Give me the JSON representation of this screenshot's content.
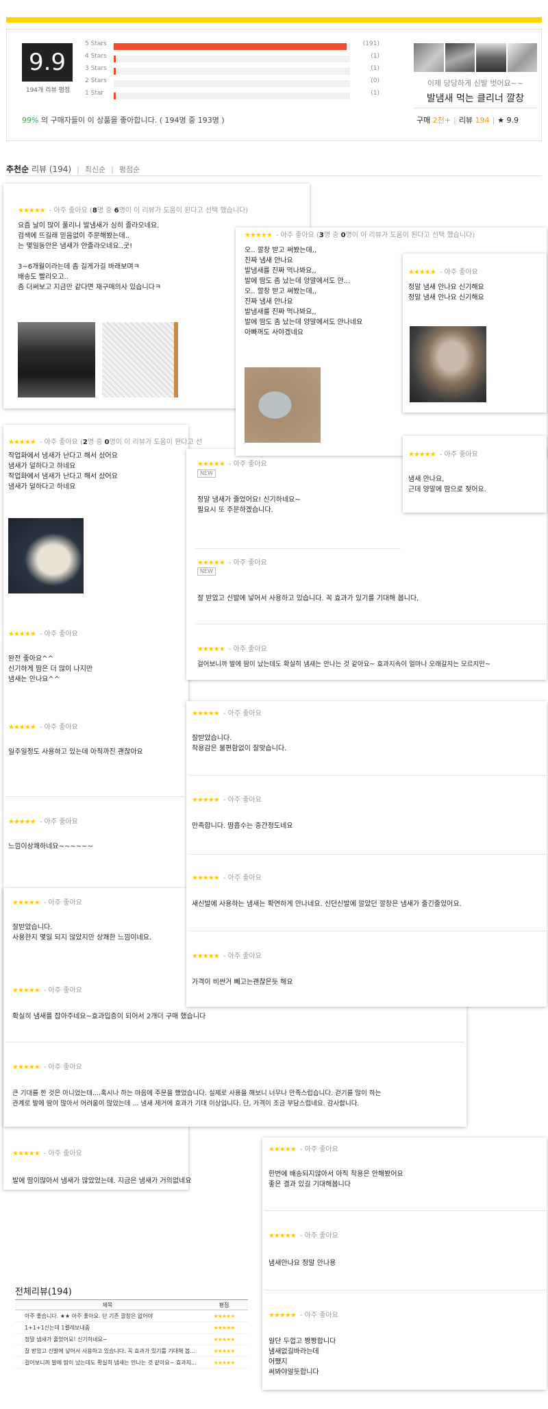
{
  "summary": {
    "score": "9.9",
    "score_caption": "194개 리뷰 평점",
    "rating_rows": [
      {
        "label": "5 Stars",
        "count": "(191)",
        "fraction": 0.985
      },
      {
        "label": "4 Stars",
        "count": "(1)",
        "fraction": 0.005
      },
      {
        "label": "3 Stars",
        "count": "(1)",
        "fraction": 0.005
      },
      {
        "label": "2 Stars",
        "count": "(0)",
        "fraction": 0
      },
      {
        "label": "1 Star",
        "count": "(1)",
        "fraction": 0.005
      }
    ],
    "pct": "99%",
    "pct_text": " 의 구매자들이 이 상품을 좋아합니다. ( 194명 중 193명 )"
  },
  "product": {
    "subtitle": "이제 당당하게 신발 벗어요~~",
    "title": "발냄새 먹는 클리너 깔창",
    "buy_label": "구매",
    "buy_value": "2천+",
    "review_label": "리뷰",
    "review_value": "194",
    "rating": "★ 9.9"
  },
  "sort": {
    "active_label": "추천순",
    "active_suffix": " 리뷰 (194)",
    "option_latest": "최신순",
    "option_rating": "평점순"
  },
  "colors": {
    "accent": "#ffd400",
    "bar": "#f04b2c",
    "star": "#ffc600",
    "positive": "#2fa84f",
    "highlight": "#f39a12"
  },
  "stars": "★★★★★",
  "reviews": {
    "r1": {
      "grade": "- 아주 좋아요",
      "helpful_pre": "(",
      "helpful_a": "8",
      "helpful_mid": "명 중 ",
      "helpful_b": "6",
      "helpful_post": "명이 이 리뷰가 도움이 된다고 선택 했습니다)",
      "text": "요즘 날이 많이 풀리니 발냄새가 심히 졸라오네요.\n검색에 뜨길래 믿음없이 주문해봤는데..\n는 몇일동안은 냄새가 안졸라오네요..굿!\n\n3~6개월이라는데 좀 길게가길 바래보며ㅋ\n배송도 빨리오고..\n좀 더써보고 지금만 같다면 재구매의사 있습니다ㅋ"
    },
    "r2": {
      "grade": "- 아주 좋아요",
      "helpful_pre": "(",
      "helpful_a": "3",
      "helpful_mid": "명 중 ",
      "helpful_b": "0",
      "helpful_post": "명이 이 리뷰가 도움이 된다고 선택 했습니다)",
      "text": "오.. 깔창 받고 써봤는데,,\n진짜 냄새 안나요\n발냄새를 진짜 먹나봐요,,\n발에 땀도 좀 났는데 양말에서도 안...\n오.. 깔창 받고 써봤는데,,\n진짜 냄새 안나요\n발냄새를 진짜 먹나봐요,,\n발에 땀도 좀 났는데 양말에서도 안나네요\n아빠꺼도 사야겠네요"
    },
    "r3": {
      "grade": "- 아주 좋아요",
      "text": "정말 냄새 안나요 신기해요\n정말 냄새 안나요 신기해요"
    },
    "r4": {
      "grade": "- 아주 좋아요",
      "helpful_pre": "(",
      "helpful_a": "2",
      "helpful_mid": "명 중 ",
      "helpful_b": "0",
      "helpful_post": "명이 이 리뷰가 도움이 된다고 선",
      "text": "작업화에서 냄새가 난다고 해서 샀어요\n냄새가 덜하다고 하네요\n작업화에서 냄새가 난다고 해서 샀어요\n냄새가 덜하다고 하네요"
    },
    "r5": {
      "grade": "- 아주 좋아요",
      "badge": "NEW",
      "text": "정말 냄새가 줄었어요! 신기하네요~\n필요시 또 주문하겠습니다."
    },
    "r6": {
      "grade": "- 아주 좋아요",
      "text": "냄새 안나요,\n근데 양말에 땀으로 젖어요."
    },
    "r7": {
      "grade": "- 아주 좋아요",
      "badge": "NEW",
      "text": "잘 받았고 신발에 넣어서 사용하고 있습니다. 꼭 효과가 있기를 기대해 봅니다,"
    },
    "r8": {
      "grade": "- 아주 좋아요",
      "text": "걸어보니까 발에 땀이 났는데도 확실히 냄새는 안나는 것 같아요~ 효과지속이 얼마나 오래갈지는 모르지만~"
    },
    "r9": {
      "grade": "- 아주 좋아요",
      "text": "완전 좋아요^^\n신기하게 땀은 더 많이 나지만\n냄새는 안나요^^"
    },
    "r10": {
      "grade": "- 아주 좋아요",
      "text": "잘받았습니다.\n착용감은 불편함없이 잘맞습니다."
    },
    "r11": {
      "grade": "- 아주 좋아요",
      "text": "일주일정도 사용하고 있는데 아직까진 괜찮아요"
    },
    "r12": {
      "grade": "- 아주 좋아요",
      "text": "만족합니다. 땀흡수는 중간정도네요"
    },
    "r13": {
      "grade": "- 아주 좋아요",
      "text": "느낌이상쾌하네요~~~~~~"
    },
    "r14": {
      "grade": "- 아주 좋아요",
      "text": "새신발에 사용하는 냄새는 확연하게 안나네요. 신던신발에 깔았던 깔창은 냄새가 줄긴줄었어요."
    },
    "r15": {
      "grade": "- 아주 좋아요",
      "text": "잘받았습니다.\n사용한지 몇일 되지 않았지만 상쾌한 느낌이네요."
    },
    "r16": {
      "grade": "- 아주 좋아요",
      "text": "가격이 비싼거 빼고는괜찮은듯 해요"
    },
    "r17": {
      "grade": "- 아주 좋아요",
      "text": "확실히 냄새를 잡아주네요~효과입증이 되어서 2개더 구매 했습니다"
    },
    "r18": {
      "grade": "- 아주 좋아요",
      "text": "큰 기대를 한 것은 아니었는데....혹시나 하는 마음에 주문을 했었습니다. 실제로 사용을 해보니 너무나 만족스럽습니다. 걷기를 많이 하는\n관계로 발에 땀이 많아서 어려움이 많았는데 ... 냄새 제거에 효과가 기대 이상입니다. 단, 가격이 조금 부담스럽네요. 감사합니다."
    },
    "r19": {
      "grade": "- 아주 좋아요",
      "text": "발에 땀이많아서 냄새가 많았었는데. 지금은 냄새가 거의없네요"
    },
    "r20": {
      "grade": "- 아주 좋아요",
      "text": "한번에 배송되지않아서 아직 착용은 안해봤어요\n좋은 결과 있길 기대해봅니다"
    },
    "r21": {
      "grade": "- 아주 좋아요",
      "text": "냄새안나요 정말 안나용"
    },
    "r22": {
      "grade": "- 아주 좋아요",
      "text": "일단 두껍고 짱짱합니다\n냄새없길바라는데\n어쨌지\n써봐야알듯합니다"
    }
  },
  "table": {
    "title": "전체리뷰(194)",
    "col_subject": "제목",
    "col_rating": "평점",
    "rows": [
      "아주 좋습니다. ★★ 아주 좋아요. 단 기존 깔창은 없어야",
      "1+1+1신는데 1켤레보내줌",
      "정말 냄새가 줄었어요! 신기하네요~",
      "잘 받았고 신발에 넣어서 사용하고 있습니다. 꼭 효과가 있기를 기대해 봅...",
      "걸어보니까 발에 땀이 났는데도 확실히 냄새는 안나는 것 같아요~ 효과지..."
    ]
  }
}
